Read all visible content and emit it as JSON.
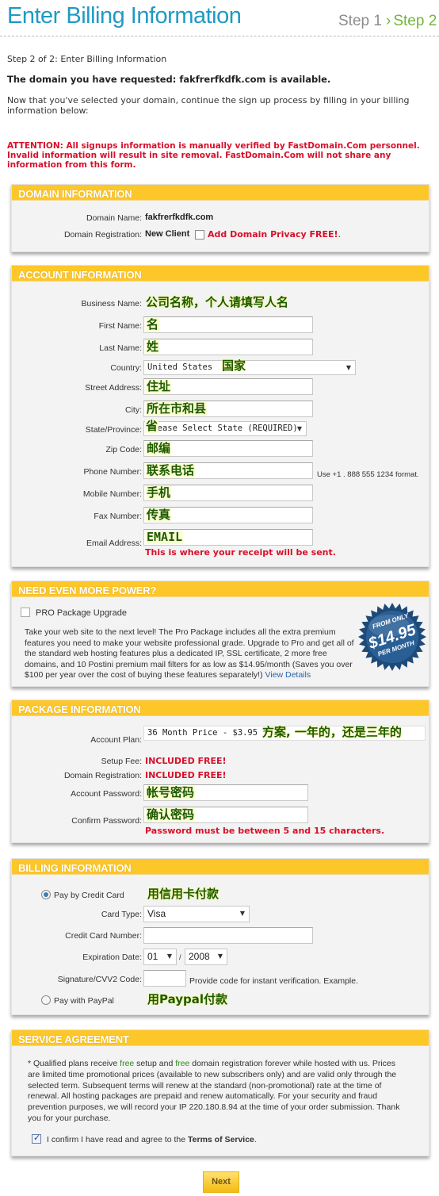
{
  "header": {
    "title": "Enter Billing Information",
    "step1": "Step 1",
    "step2_chevron": "›",
    "step2": "Step 2"
  },
  "intro": {
    "step_text": "Step 2 of 2: Enter Billing Information",
    "domain_available": "The domain you have requested: fakfrerfkdfk.com is available.",
    "description": "Now that you've selected your domain, continue the sign up process by filling in your billing information below:",
    "attention": "ATTENTION: All signups information is manually verified by FastDomain.Com personnel. Invalid information will result in site removal. FastDomain.Com will not share any information from this form."
  },
  "domain_info": {
    "title": "DOMAIN INFORMATION",
    "domain_name_label": "Domain Name:",
    "domain_name_value": "fakfrerfkdfk.com",
    "registration_label": "Domain Registration:",
    "registration_value": "New Client",
    "privacy_checked": false,
    "privacy_label": "Add Domain Privacy FREE!",
    "privacy_suffix": "."
  },
  "account_info": {
    "title": "ACCOUNT INFORMATION",
    "fields": {
      "business_name": {
        "label": "Business Name:",
        "annotation": "公司名称，个人请填写人名"
      },
      "first_name": {
        "label": "First Name:",
        "annotation": "名"
      },
      "last_name": {
        "label": "Last Name:",
        "annotation": "姓"
      },
      "country": {
        "label": "Country:",
        "selected": "United States",
        "annotation": "国家"
      },
      "street_address": {
        "label": "Street Address:",
        "annotation": "住址"
      },
      "city": {
        "label": "City:",
        "annotation": "所在市和县"
      },
      "state": {
        "label": "State/Province:",
        "selected": "Please Select State (REQUIRED)",
        "annotation": "省"
      },
      "zip": {
        "label": "Zip Code:",
        "annotation": "邮编"
      },
      "phone": {
        "label": "Phone Number:",
        "annotation": "联系电话",
        "hint": "Use +1 . 888 555 1234 format."
      },
      "mobile": {
        "label": "Mobile Number:",
        "annotation": "手机"
      },
      "fax": {
        "label": "Fax Number:",
        "annotation": "传真"
      },
      "email": {
        "label": "Email Address:",
        "annotation": "EMAIL",
        "note": "This is where your receipt will be sent."
      }
    }
  },
  "pro_upgrade": {
    "title": "NEED EVEN MORE POWER?",
    "checkbox_checked": false,
    "checkbox_label": "PRO Package Upgrade",
    "description": "Take your web site to the next level! The Pro Package includes all the extra premium features you need to make your website professional grade. Upgrade to Pro and get all of the standard web hosting features plus a dedicated IP, SSL certificate, 2 more free domains, and 10 Postini premium mail filters for as low as $14.95/month (Saves you over $100 per year over the cost of buying these features separately!)",
    "view_details": "View Details",
    "badge": {
      "top": "FROM ONLY",
      "price": "$14.95",
      "bottom": "PER MONTH",
      "color": "#2a5f96"
    }
  },
  "package_info": {
    "title": "PACKAGE INFORMATION",
    "plan_label": "Account Plan:",
    "plan_selected": "36 Month Price - $3.95 *",
    "plan_annotation": "方案, 一年的，还是三年的",
    "setup_fee_label": "Setup Fee:",
    "setup_fee_value": "INCLUDED FREE!",
    "domain_reg_label": "Domain Registration:",
    "domain_reg_value": "INCLUDED FREE!",
    "password_label": "Account Password:",
    "password_annotation": "帐号密码",
    "confirm_label": "Confirm Password:",
    "confirm_annotation": "确认密码",
    "password_note": "Password must be between 5 and 15 characters."
  },
  "billing_info": {
    "title": "BILLING INFORMATION",
    "pay_credit_label": "Pay by Credit Card",
    "pay_credit_selected": true,
    "pay_credit_annotation": "用信用卡付款",
    "card_type_label": "Card Type:",
    "card_type_selected": "Visa",
    "card_number_label": "Credit Card Number:",
    "card_number_value": "",
    "expiration_label": "Expiration Date:",
    "exp_month": "01",
    "exp_separator": "/",
    "exp_year": "2008",
    "cvv_label": "Signature/CVV2 Code:",
    "cvv_hint": "Provide code for instant verification. Example.",
    "pay_paypal_label": "Pay with PayPal",
    "pay_paypal_selected": false,
    "pay_paypal_annotation": "用Paypal付款"
  },
  "service_agreement": {
    "title": "SERVICE AGREEMENT",
    "text_1": "* Qualified plans receive ",
    "free_1": "free",
    "text_2": " setup and ",
    "free_2": "free",
    "text_3": " domain registration forever while hosted with us. Prices are limited time promotional prices (available to new subscribers only) and are valid only through the selected term. Subsequent terms will renew at the standard (non-promotional) rate at the time of renewal. All hosting packages are prepaid and renew automatically. For your security and fraud prevention purposes, we will record your IP 220.180.8.94 at the time of your order submission. Thank you for your purchase.",
    "confirm_checked": true,
    "confirm_text": "I confirm I have read and agree to the ",
    "tos_link": "Terms of Service",
    "confirm_suffix": "."
  },
  "next_button": "Next"
}
